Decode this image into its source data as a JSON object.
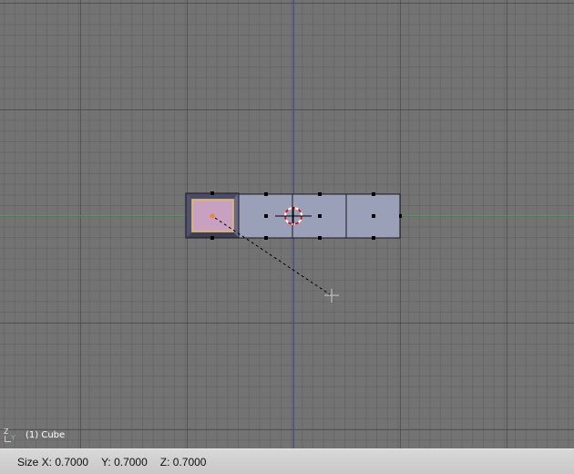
{
  "viewport": {
    "object_label": "(1) Cube",
    "axis_gizmo": {
      "up_axis": "Z",
      "right_axis": "Y"
    },
    "colors": {
      "background": "#737373",
      "x_axis": "#5ca05c",
      "y_axis": "#4b4ba0",
      "mesh_face": "#9aa0b8",
      "selected_face": "#c8a0c0",
      "selected_edge": "#e0c060",
      "vertex": "#000000",
      "pivot": "#e88a2a",
      "cursor_red": "#d01010"
    }
  },
  "status_bar": {
    "size_x": "Size X: 0.7000",
    "size_y": "Y: 0.7000",
    "size_z": "Z: 0.7000"
  }
}
